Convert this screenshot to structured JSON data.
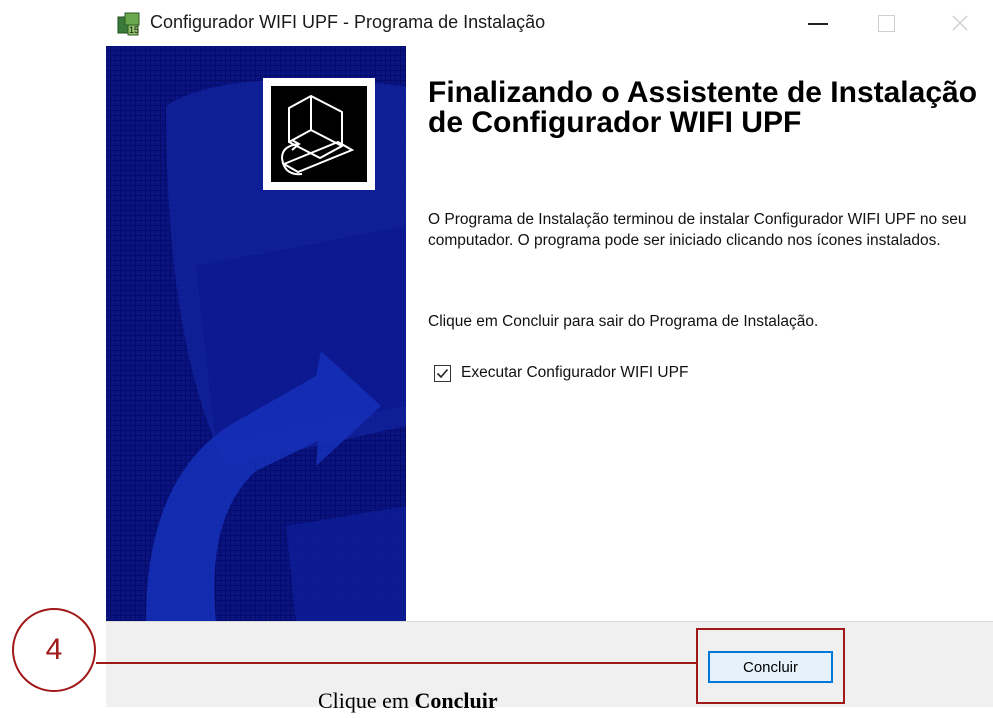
{
  "window": {
    "title": "Configurador WIFI UPF - Programa de Instalação"
  },
  "content": {
    "heading": "Finalizando o Assistente de Instalação de Configurador WIFI UPF",
    "paragraph1": "O Programa de Instalação terminou de instalar Configurador WIFI UPF no seu computador. O programa pode ser iniciado clicando nos ícones instalados.",
    "paragraph2": "Clique em Concluir para sair do Programa de Instalação.",
    "checkbox": {
      "label": "Executar Configurador WIFI UPF",
      "checked": true
    }
  },
  "footer": {
    "finish_label": "Concluir"
  },
  "annotation": {
    "step_number": "4",
    "caption_prefix": "Clique em ",
    "caption_bold": "Concluir",
    "color": "#a01818"
  },
  "colors": {
    "banner": "#060a6b",
    "button_border": "#0078d7"
  }
}
